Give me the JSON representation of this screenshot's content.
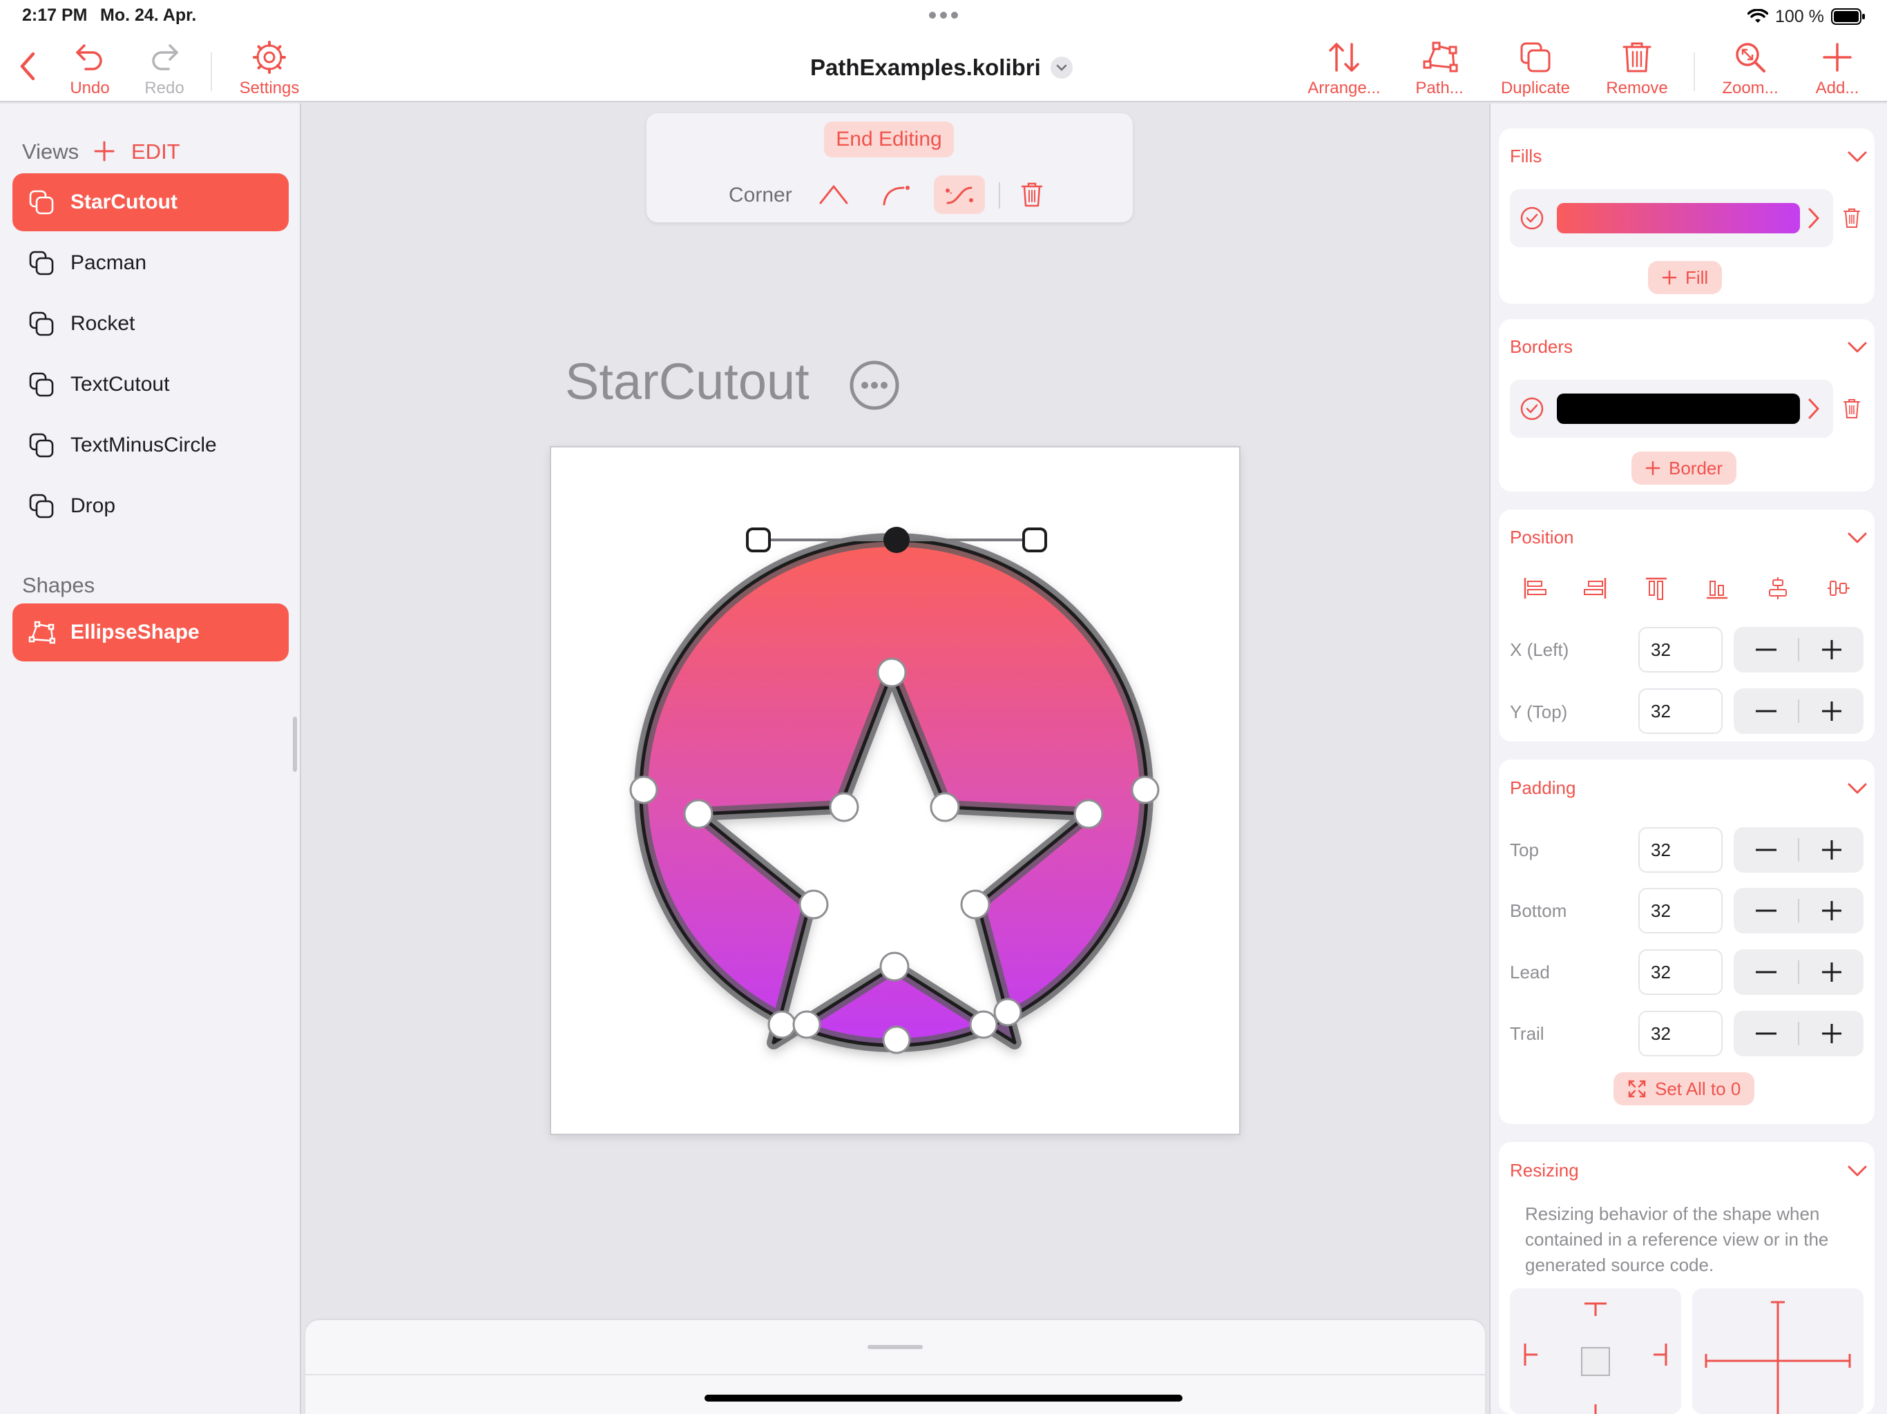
{
  "status": {
    "time": "2:17 PM",
    "date": "Mo. 24. Apr.",
    "battery": "100 %"
  },
  "toolbar": {
    "undo": "Undo",
    "redo": "Redo",
    "settings": "Settings",
    "doc_title": "PathExamples.kolibri",
    "arrange": "Arrange...",
    "path": "Path...",
    "duplicate": "Duplicate",
    "remove": "Remove",
    "zoom": "Zoom...",
    "add": "Add..."
  },
  "sidebar": {
    "views_title": "Views",
    "edit_label": "EDIT",
    "views": [
      {
        "label": "StarCutout",
        "active": true
      },
      {
        "label": "Pacman",
        "active": false
      },
      {
        "label": "Rocket",
        "active": false
      },
      {
        "label": "TextCutout",
        "active": false
      },
      {
        "label": "TextMinusCircle",
        "active": false
      },
      {
        "label": "Drop",
        "active": false
      }
    ],
    "shapes_title": "Shapes",
    "shapes": [
      {
        "label": "EllipseShape",
        "active": true
      }
    ]
  },
  "canvas": {
    "end_editing": "End Editing",
    "corner_label": "Corner",
    "view_title": "StarCutout"
  },
  "inspector": {
    "fills": {
      "title": "Fills",
      "add_label": "Fill",
      "gradient_top": "#f95c5c",
      "gradient_bottom": "#c43ff0"
    },
    "borders": {
      "title": "Borders",
      "add_label": "Border",
      "color": "#000000"
    },
    "position": {
      "title": "Position",
      "x_label": "X (Left)",
      "x_value": "32",
      "y_label": "Y (Top)",
      "y_value": "32"
    },
    "padding": {
      "title": "Padding",
      "rows": [
        {
          "label": "Top",
          "value": "32"
        },
        {
          "label": "Bottom",
          "value": "32"
        },
        {
          "label": "Lead",
          "value": "32"
        },
        {
          "label": "Trail",
          "value": "32"
        }
      ],
      "set_all": "Set All to 0"
    },
    "resizing": {
      "title": "Resizing",
      "description": "Resizing behavior of the shape when contained in a reference view or in the generated source code."
    }
  },
  "colors": {
    "accent": "#f0524c",
    "accent_light": "#fcd8d5",
    "selection": "#f85a4e"
  }
}
